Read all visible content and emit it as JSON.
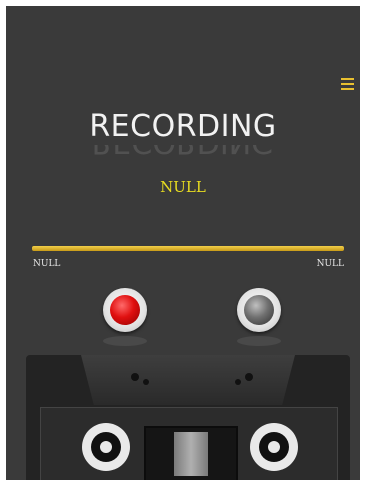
{
  "header": {
    "menu_icon": "menu-icon"
  },
  "main": {
    "title": "RECORDING",
    "status": "NULL",
    "progress": {
      "fraction": 1.0,
      "elapsed": "NULL",
      "total": "NULL"
    }
  },
  "controls": {
    "record_icon": "record-icon",
    "stop_icon": "stop-icon"
  },
  "colors": {
    "accent": "#e8c030",
    "status_text": "#e8dc20",
    "background": "#3a3a3a",
    "record": "#e01010"
  }
}
